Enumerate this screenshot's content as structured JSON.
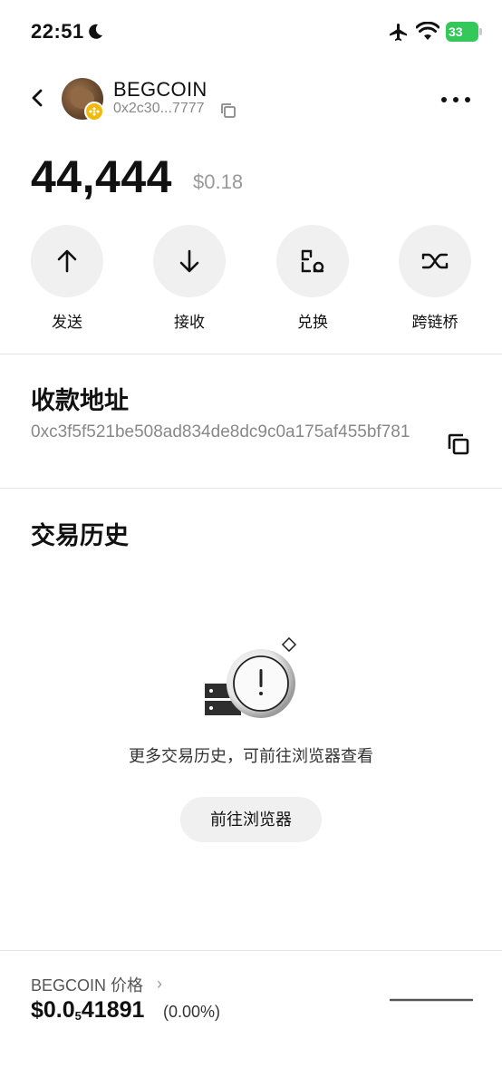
{
  "status_bar": {
    "time": "22:51",
    "battery": "33"
  },
  "header": {
    "token_name": "BEGCOIN",
    "token_address_short": "0x2c30...7777",
    "icons": [
      "back-icon",
      "copy-icon",
      "more-icon"
    ]
  },
  "balance": {
    "amount": "44,444",
    "usd_value": "$0.18"
  },
  "actions": [
    {
      "label": "发送",
      "icon": "arrow-up-icon"
    },
    {
      "label": "接收",
      "icon": "arrow-down-icon"
    },
    {
      "label": "兑换",
      "icon": "swap-icon"
    },
    {
      "label": "跨链桥",
      "icon": "bridge-icon"
    }
  ],
  "receive": {
    "title": "收款地址",
    "address": "0xc3f5f521be508ad834de8dc9c0a175af455bf781"
  },
  "history": {
    "title": "交易历史",
    "empty_text": "更多交易历史，可前往浏览器查看",
    "explorer_button": "前往浏览器"
  },
  "price": {
    "label": "BEGCOIN 价格",
    "value_prefix": "$0.0",
    "value_zero_count": "5",
    "value_digits": "41891",
    "change": "(0.00%)"
  },
  "colors": {
    "battery": "#34c759",
    "chain_badge": "#f0b90b",
    "action_bg": "#f0f0f0"
  }
}
